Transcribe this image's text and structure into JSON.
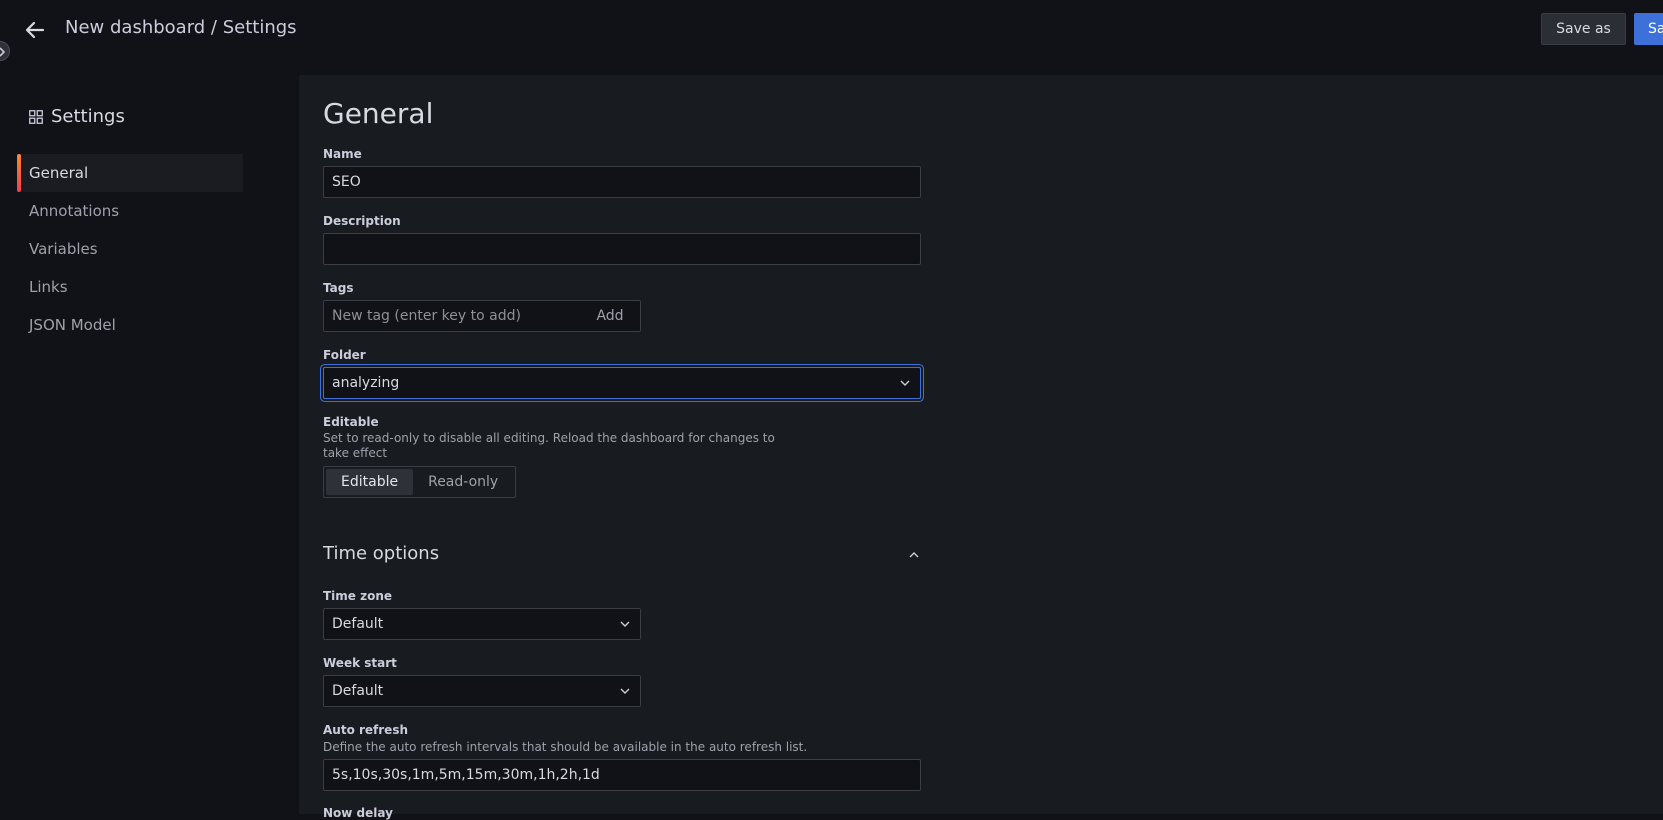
{
  "header": {
    "title": "New dashboard / Settings",
    "save_as_label": "Save as",
    "save_label": "Save"
  },
  "sidebar": {
    "title": "Settings",
    "title_icon": "apps-grid-icon",
    "items": [
      {
        "label": "General",
        "active": true
      },
      {
        "label": "Annotations",
        "active": false
      },
      {
        "label": "Variables",
        "active": false
      },
      {
        "label": "Links",
        "active": false
      },
      {
        "label": "JSON Model",
        "active": false
      }
    ]
  },
  "general": {
    "heading": "General",
    "name": {
      "label": "Name",
      "value": "SEO"
    },
    "description": {
      "label": "Description",
      "value": ""
    },
    "tags": {
      "label": "Tags",
      "placeholder": "New tag (enter key to add)",
      "add_label": "Add"
    },
    "folder": {
      "label": "Folder",
      "value": "analyzing"
    },
    "editable": {
      "label": "Editable",
      "description": "Set to read-only to disable all editing. Reload the dashboard for changes to take effect",
      "options": [
        "Editable",
        "Read-only"
      ],
      "selected": "Editable"
    }
  },
  "time_options": {
    "title": "Time options",
    "time_zone": {
      "label": "Time zone",
      "value": "Default"
    },
    "week_start": {
      "label": "Week start",
      "value": "Default"
    },
    "auto_refresh": {
      "label": "Auto refresh",
      "description": "Define the auto refresh intervals that should be available in the auto refresh list.",
      "value": "5s,10s,30s,1m,5m,15m,30m,1h,2h,1d"
    },
    "now_delay": {
      "label": "Now delay"
    }
  },
  "colors": {
    "background": "#111217",
    "panel": "#181b1f",
    "primary": "#3d71d9",
    "active_accent": "#ff8833"
  }
}
